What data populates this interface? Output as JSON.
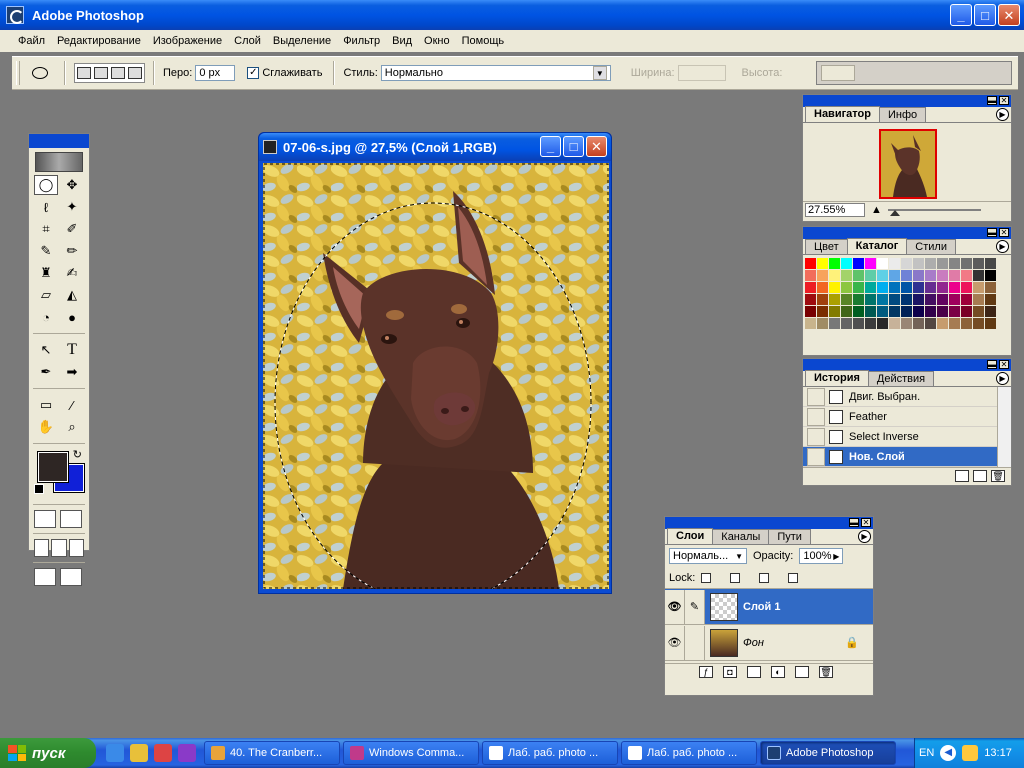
{
  "app": {
    "title": "Adobe Photoshop"
  },
  "menu": [
    "Файл",
    "Редактирование",
    "Изображение",
    "Слой",
    "Выделение",
    "Фильтр",
    "Вид",
    "Окно",
    "Помощь"
  ],
  "options": {
    "feather_label": "Перо:",
    "feather_value": "0 px",
    "antialias_label": "Сглаживать",
    "antialias_checked": "✓",
    "style_label": "Стиль:",
    "style_value": "Нормально",
    "width_label": "Ширина:",
    "height_label": "Высота:"
  },
  "document": {
    "title": "07-06-s.jpg @ 27,5% (Слой 1,RGB)"
  },
  "navigator": {
    "tabs": [
      "Навигатор",
      "Инфо"
    ],
    "zoom": "27.55%"
  },
  "swatches": {
    "tabs": [
      "Цвет",
      "Каталог",
      "Стили"
    ],
    "colors": [
      "#ff0000",
      "#ffff00",
      "#00ff00",
      "#00ffff",
      "#0000ff",
      "#ff00ff",
      "#ffffff",
      "#ebebeb",
      "#d6d6d6",
      "#c2c2c2",
      "#adadad",
      "#999999",
      "#858585",
      "#707070",
      "#5c5c5c",
      "#474747",
      "#f26d5b",
      "#f7a35c",
      "#fff27a",
      "#a3d36a",
      "#5fc36a",
      "#5fcda8",
      "#5fd0e6",
      "#5fa6e6",
      "#6f82d6",
      "#8a78c9",
      "#a87cc9",
      "#c97cbf",
      "#e07ba7",
      "#f27a86",
      "#333333",
      "#000000",
      "#ed1c24",
      "#f26522",
      "#fff200",
      "#8dc63f",
      "#39b54a",
      "#00a99d",
      "#00aeef",
      "#0072bc",
      "#0054a6",
      "#2e3192",
      "#662d91",
      "#92278f",
      "#ec008c",
      "#ed145b",
      "#c69c6d",
      "#8c6239",
      "#9e0b0f",
      "#a0410d",
      "#aba000",
      "#598527",
      "#197b30",
      "#00746b",
      "#0076a3",
      "#004a80",
      "#003471",
      "#1b1464",
      "#440e62",
      "#630460",
      "#9e005d",
      "#9e0039",
      "#a67c52",
      "#603913",
      "#790000",
      "#7b2e00",
      "#827b00",
      "#406618",
      "#005e20",
      "#005952",
      "#005b7f",
      "#003663",
      "#002157",
      "#0d004c",
      "#32004b",
      "#4b0049",
      "#7b0046",
      "#7a0026",
      "#754c24",
      "#3c2415",
      "#c8b48c",
      "#a08c64",
      "#787878",
      "#646464",
      "#505050",
      "#3c3c3c",
      "#282828",
      "#c7b299",
      "#998675",
      "#736357",
      "#534741",
      "#c69c6d",
      "#a67c52",
      "#8c6239",
      "#754c24",
      "#603913"
    ]
  },
  "history": {
    "tabs": [
      "История",
      "Действия"
    ],
    "items": [
      "Двиг. Выбран.",
      "Feather",
      "Select Inverse",
      "Нов. Слой"
    ]
  },
  "layers": {
    "tabs": [
      "Слои",
      "Каналы",
      "Пути"
    ],
    "blend_mode": "Нормаль...",
    "opacity_label": "Opacity:",
    "opacity_value": "100%",
    "lock_label": "Lock:",
    "items": [
      "Слой 1",
      "Фон"
    ]
  },
  "taskbar": {
    "start": "пуск",
    "tasks": [
      "40. The Cranberr...",
      "Windows Comma...",
      "Лаб. раб. photo ...",
      "Лаб. раб. photo ...",
      "Adobe Photoshop"
    ],
    "lang": "EN",
    "clock": "13:17"
  }
}
